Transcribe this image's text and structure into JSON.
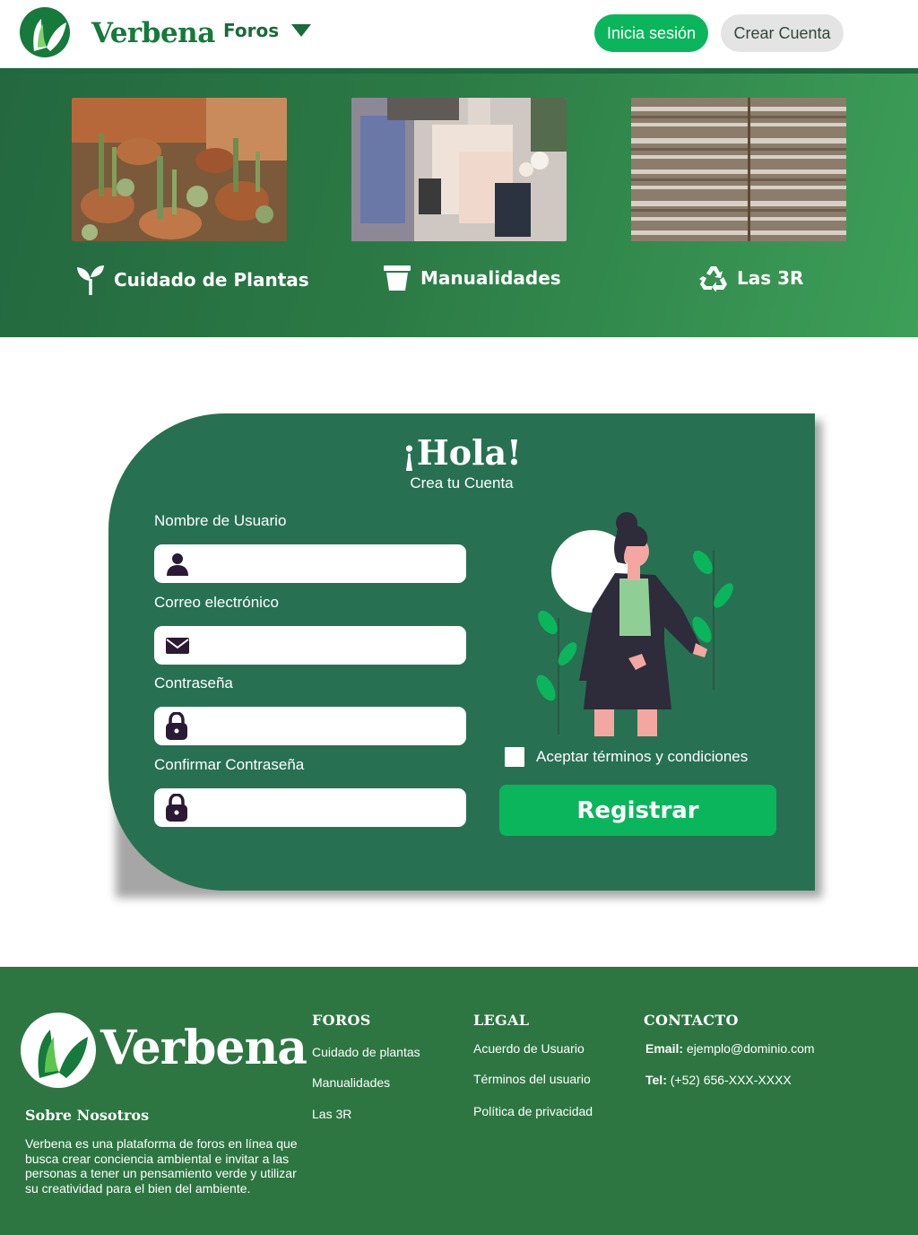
{
  "header": {
    "logo_text": "Verbena",
    "nav_foros_label": "Foros",
    "login_label": "Inicia sesión",
    "signup_label": "Crear Cuenta"
  },
  "hero": {
    "cards": [
      {
        "label": "Cuidado de Plantas",
        "icon": "sprout-icon"
      },
      {
        "label": "Manualidades",
        "icon": "flowerpot-icon"
      },
      {
        "label": "Las 3R",
        "icon": "recycle-icon"
      }
    ]
  },
  "form": {
    "title": "¡Hola!",
    "subtitle": "Crea tu Cuenta",
    "fields": [
      {
        "label": "Nombre de Usuario",
        "icon": "user-icon",
        "value": "",
        "placeholder": ""
      },
      {
        "label": "Correo electrónico",
        "icon": "envelope-icon",
        "value": "",
        "placeholder": ""
      },
      {
        "label": "Contraseña",
        "icon": "lock-icon",
        "value": "",
        "placeholder": ""
      },
      {
        "label": "Confirmar Contraseña",
        "icon": "lock-icon",
        "value": "",
        "placeholder": ""
      }
    ],
    "terms_label": "Aceptar términos y condiciones",
    "terms_checked": false,
    "register_label": "Registrar"
  },
  "footer": {
    "logo_text": "Verbena",
    "about_title": "Sobre Nosotros",
    "about_text": "Verbena es una plataforma de foros en línea que busca crear conciencia ambiental e invitar a las personas a tener un pensamiento verde y utilizar su creatividad para el bien del ambiente.",
    "foros_title": "FOROS",
    "foros_links": [
      "Cuidado de plantas",
      "Manualidades",
      "Las 3R"
    ],
    "legal_title": "LEGAL",
    "legal_links": [
      "Acuerdo de Usuario",
      "Términos del usuario",
      "Política de privacidad"
    ],
    "contact_title": "CONTACTO",
    "email_label": "Email:",
    "email_value": "ejemplo@dominio.com",
    "phone_label": "Tel:",
    "phone_value": "(+52) 656-XXX-XXXX"
  },
  "colors": {
    "brand_green": "#157a3b",
    "accent_green": "#0bb55c",
    "card_green": "#277152",
    "footer_green": "#2d7642"
  }
}
